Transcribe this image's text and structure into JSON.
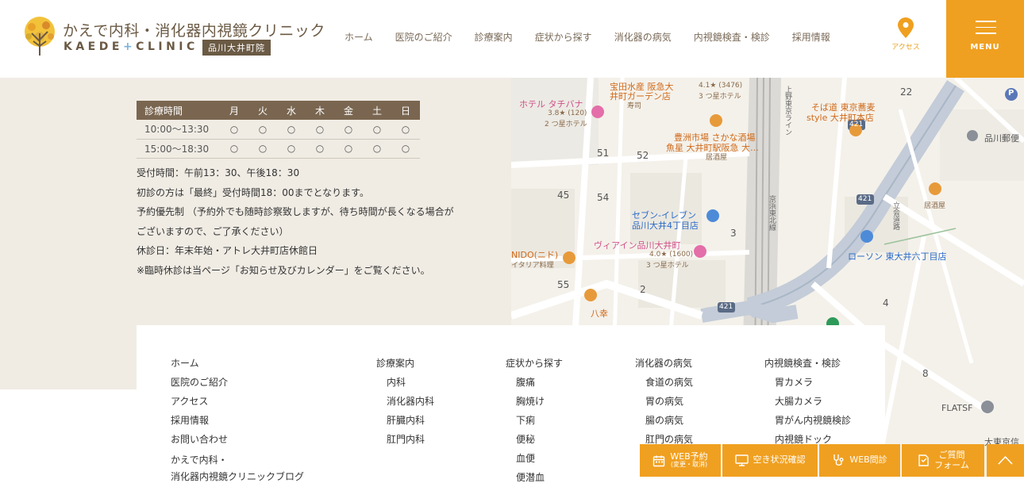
{
  "header": {
    "logo_jp": "かえで内科・消化器内視鏡クリニック",
    "logo_en_left": "KAEDE",
    "logo_en_plus": "+",
    "logo_en_right": "CLINIC",
    "logo_branch": "品川大井町院",
    "nav": [
      "ホーム",
      "医院のご紹介",
      "診療案内",
      "症状から探す",
      "消化器の病気",
      "内視鏡検査・検診",
      "採用情報"
    ],
    "access_label": "アクセス",
    "menu_label": "MENU",
    "accent_color": "#f0a020"
  },
  "hours": {
    "header": [
      "診療時間",
      "月",
      "火",
      "水",
      "木",
      "金",
      "土",
      "日"
    ],
    "rows": [
      [
        "10:00〜13:30",
        "○",
        "○",
        "○",
        "○",
        "○",
        "○",
        "○"
      ],
      [
        "15:00〜18:30",
        "○",
        "○",
        "○",
        "○",
        "○",
        "○",
        "○"
      ]
    ]
  },
  "notes": [
    "受付時間：午前13：30、午後18：30",
    "初診の方は「最終」受付時間18：00までとなります。",
    "予約優先制 （予約外でも随時診察致しますが、待ち時間が長くなる場合が",
    "ございますので、ご了承ください）",
    "休診日：年末年始・アトレ大井町店休館日",
    "※臨時休診は当ページ「お知らせ及びカレンダー」をご覧ください。"
  ],
  "map": {
    "labels": {
      "l1": "宝田水産 阪急大",
      "l2": "井町ガーデン店",
      "l3": "寿司",
      "l4": "ホテル タチバナ",
      "l5": "3.8★ (120)",
      "l6": "2 つ星ホテル",
      "l7": "4.1★ (3476)",
      "l8": "3 つ星ホテル",
      "l9": "豊洲市場 さかな酒場",
      "l10": "魚星 大井町駅阪急 大…",
      "l11": "居酒屋",
      "l12": "そば道 東京蕎麦",
      "l13": "style 大井町本店",
      "l14": "品川郵便",
      "l15": "セブン-イレブン",
      "l16": "品川大井4丁目店",
      "l17": "ヴィアイン品川大井町",
      "l18": "4.0★ (1600)",
      "l19": "3 つ星ホテル",
      "l20": "ローソン 東大井六丁目店",
      "l21": "NIDO(ニド)",
      "l22": "イタリア料理",
      "l23": "八幸",
      "l24": "居酒屋",
      "l25": "FLATSF",
      "l26": "大東京信",
      "l27": "京浜東北線",
      "l28": "上野東京ライン",
      "l29": "立会道路",
      "n51": "51",
      "n52": "52",
      "n45": "45",
      "n54": "54",
      "n55": "55",
      "n2": "2",
      "n3": "3",
      "n4": "4",
      "n8": "8",
      "n22": "22",
      "r421a": "421",
      "r421b": "421",
      "r421c": "421",
      "p": "P"
    }
  },
  "footer": {
    "col1": [
      "ホーム",
      "医院のご紹介",
      "アクセス",
      "採用情報",
      "お問い合わせ",
      "かえで内科・",
      "消化器内視鏡クリニックブログ"
    ],
    "col2_head": "診療案内",
    "col2": [
      "内科",
      "消化器内科",
      "肝臓内科",
      "肛門内科"
    ],
    "col3_head": "症状から探す",
    "col3": [
      "腹痛",
      "胸焼け",
      "下痢",
      "便秘",
      "血便",
      "便潜血"
    ],
    "col4_head": "消化器の病気",
    "col4": [
      "食道の病気",
      "胃の病気",
      "腸の病気",
      "肛門の病気"
    ],
    "col5_head": "内視鏡検査・検診",
    "col5": [
      "胃カメラ",
      "大腸カメラ",
      "胃がん内視鏡検診",
      "内視鏡ドック"
    ]
  },
  "bottom_bar": {
    "web_reserve": "WEB予約",
    "web_reserve_sub": "(変更・取消)",
    "availability": "空き状況確認",
    "web_consult": "WEB問診",
    "question_line1": "ご質問",
    "question_line2": "フォーム"
  }
}
